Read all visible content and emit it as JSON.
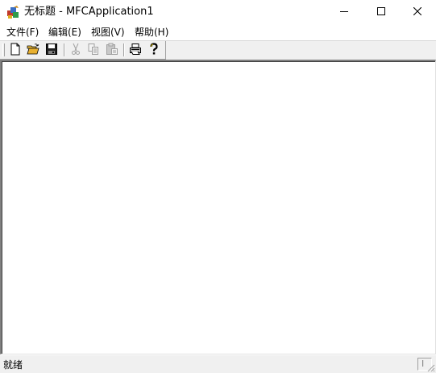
{
  "window": {
    "title": "无标题 - MFCApplication1",
    "icon": "mfc-app-icon",
    "controls": [
      "minimize-icon",
      "maximize-icon",
      "close-icon"
    ]
  },
  "menu": {
    "items": [
      {
        "label": "文件(F)"
      },
      {
        "label": "编辑(E)"
      },
      {
        "label": "视图(V)"
      },
      {
        "label": "帮助(H)"
      }
    ]
  },
  "toolbar": {
    "buttons": [
      {
        "icon": "new-file-icon",
        "enabled": true
      },
      {
        "icon": "open-folder-icon",
        "enabled": true
      },
      {
        "icon": "save-disk-icon",
        "enabled": true
      },
      {
        "icon": "cut-icon",
        "enabled": false
      },
      {
        "icon": "copy-icon",
        "enabled": false
      },
      {
        "icon": "paste-icon",
        "enabled": false
      },
      {
        "icon": "print-icon",
        "enabled": true
      },
      {
        "icon": "help-context-icon",
        "enabled": true
      }
    ]
  },
  "statusbar": {
    "text": "就绪",
    "indicator": "I"
  },
  "colors": {
    "chrome": "#f0f0f0",
    "client_bg": "#ffffff",
    "disabled_icon": "#a0a0a0"
  }
}
